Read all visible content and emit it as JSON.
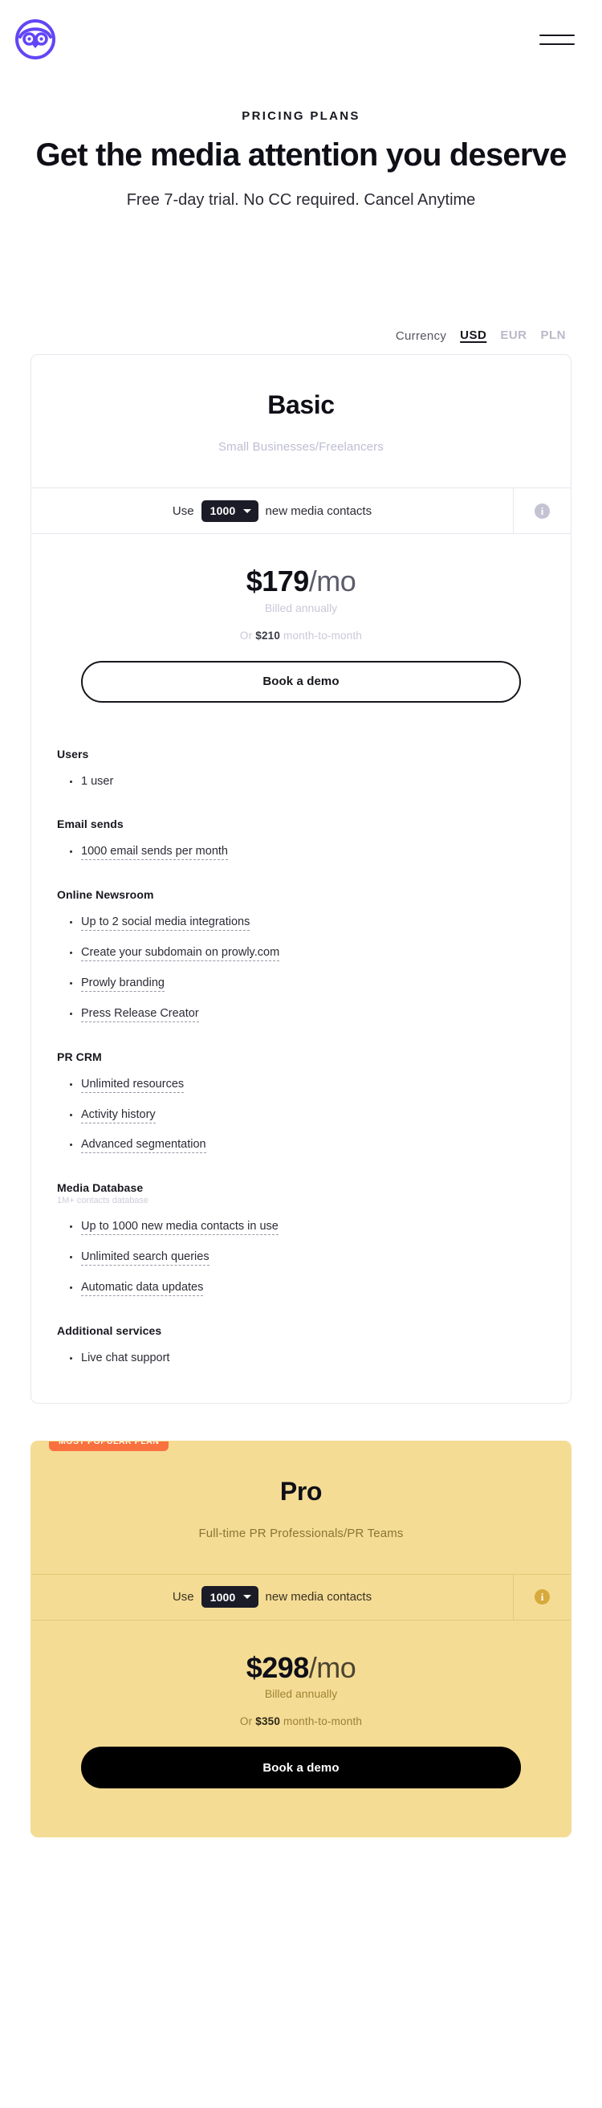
{
  "header": {
    "logo_name": "prowly-owl-logo",
    "menu_label": "Menu"
  },
  "hero": {
    "eyebrow": "PRICING PLANS",
    "title": "Get the media attention you deserve",
    "subtitle": "Free 7-day trial. No CC required. Cancel Anytime"
  },
  "currency": {
    "label": "Currency",
    "options": [
      "USD",
      "EUR",
      "PLN"
    ],
    "selected": "USD"
  },
  "plans": [
    {
      "id": "basic",
      "name": "Basic",
      "audience": "Small Businesses/Freelancers",
      "badge": null,
      "contacts": {
        "prefix": "Use",
        "value": "1000",
        "suffix": "new media contacts",
        "info_glyph": "i"
      },
      "price": {
        "amount": "$179",
        "period": "/mo",
        "billed": "Billed annually",
        "alt_prefix": "Or",
        "alt_amount": "$210",
        "alt_suffix": "month-to-month"
      },
      "cta": "Book a demo",
      "feature_groups": [
        {
          "title": "Users",
          "subtitle": null,
          "items": [
            {
              "text": "1 user",
              "tooltip": false
            }
          ]
        },
        {
          "title": "Email sends",
          "subtitle": null,
          "items": [
            {
              "text": "1000 email sends per month",
              "tooltip": true
            }
          ]
        },
        {
          "title": "Online Newsroom",
          "subtitle": null,
          "items": [
            {
              "text": "Up to 2 social media integrations",
              "tooltip": true
            },
            {
              "text": "Create your subdomain on prowly.com",
              "tooltip": true
            },
            {
              "text": "Prowly branding",
              "tooltip": true
            },
            {
              "text": "Press Release Creator",
              "tooltip": true
            }
          ]
        },
        {
          "title": "PR CRM",
          "subtitle": null,
          "items": [
            {
              "text": "Unlimited resources",
              "tooltip": true
            },
            {
              "text": "Activity history",
              "tooltip": true
            },
            {
              "text": "Advanced segmentation",
              "tooltip": true
            }
          ]
        },
        {
          "title": "Media Database",
          "subtitle": "1M+ contacts database",
          "items": [
            {
              "text": "Up to 1000 new media contacts in use",
              "tooltip": true
            },
            {
              "text": "Unlimited search queries",
              "tooltip": true
            },
            {
              "text": "Automatic data updates",
              "tooltip": true
            }
          ]
        },
        {
          "title": "Additional services",
          "subtitle": null,
          "items": [
            {
              "text": "Live chat support",
              "tooltip": false
            }
          ]
        }
      ]
    },
    {
      "id": "pro",
      "name": "Pro",
      "audience": "Full-time PR Professionals/PR Teams",
      "badge": "MOST POPULAR PLAN",
      "contacts": {
        "prefix": "Use",
        "value": "1000",
        "suffix": "new media contacts",
        "info_glyph": "i"
      },
      "price": {
        "amount": "$298",
        "period": "/mo",
        "billed": "Billed annually",
        "alt_prefix": "Or",
        "alt_amount": "$350",
        "alt_suffix": "month-to-month"
      },
      "cta": "Book a demo",
      "feature_groups": []
    }
  ],
  "colors": {
    "brand_purple": "#6246f5",
    "pro_card_bg": "#f4dc95",
    "badge_orange": "#f9713f",
    "ink": "#16161d"
  }
}
